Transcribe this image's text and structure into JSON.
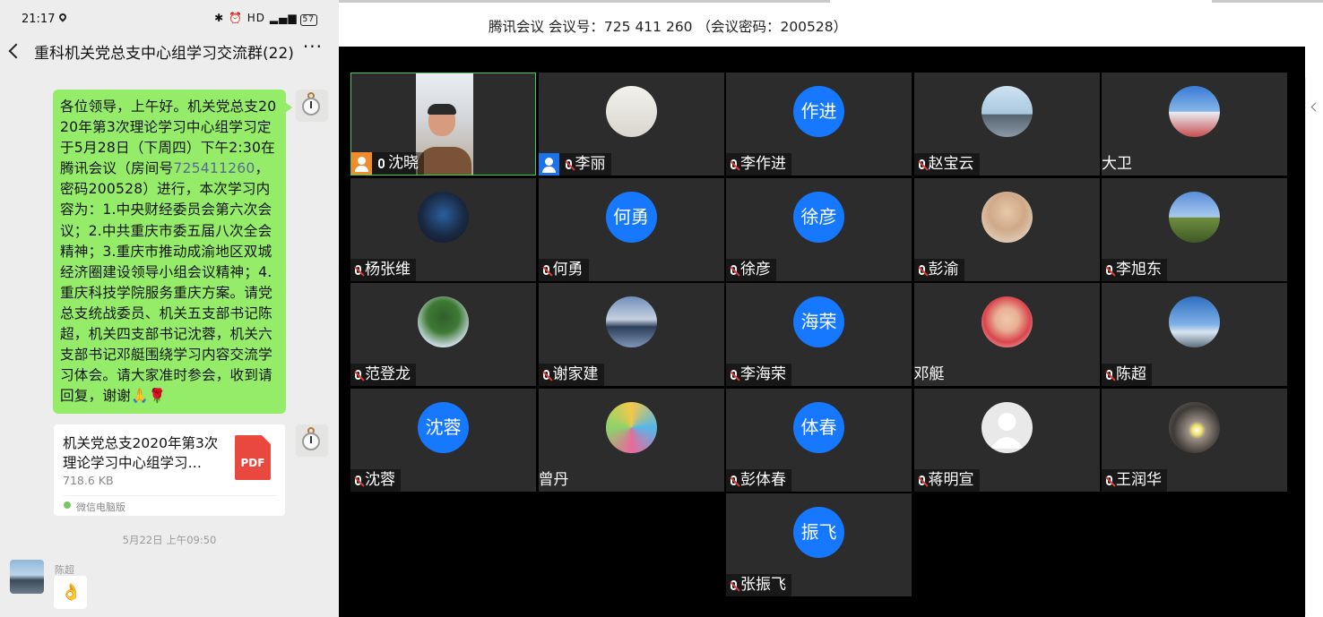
{
  "phone": {
    "status": {
      "time": "21:17",
      "icons": "✱ ⏰ HD",
      "battery": "57"
    },
    "chat": {
      "title": "重科机关党总支中心组学习交流群(22)",
      "more": "···"
    },
    "message1": {
      "text_a": "各位领导，上午好。机关党总支2020年第3次理论学习中心组学习定于5月28日（下周四）下午2:30在腾讯会议（房间号",
      "room_link": "725411260",
      "text_b": "，密码200528）进行，本次学习内容为：1.中央财经委员会第六次会议；2.中共重庆市委五届八次全会精神；3.重庆市推动成渝地区双城经济圈建设领导小组会议精神；4.重庆科技学院服务重庆方案。请党总支统战委员、机关五支部书记陈超，机关四支部书记沈蓉，机关六支部书记邓艇围绕学习内容交流学习体会。请大家准时参会，收到请回复，谢谢🙏🌹"
    },
    "file": {
      "name": "机关党总支2020年第3次理论学习中心组学习…",
      "size": "718.6 KB",
      "badge": "PDF",
      "source": "微信电脑版"
    },
    "timestamp": "5月22日 上午09:50",
    "sender2": {
      "name": "陈超",
      "emoji": "👌"
    }
  },
  "meeting": {
    "title": "腾讯会议 会议号：725 411 260 （会议密码：200528）",
    "accent": "#1678ff",
    "participants": [
      {
        "name": "沈晓",
        "avatar": "camera-video",
        "badge": "host-orange",
        "mic": "on",
        "active": true
      },
      {
        "name": "李丽",
        "avatar": "clock-photo",
        "badge": "host-blue",
        "mic": "muted"
      },
      {
        "name": "李作进",
        "avatar": "text",
        "avatar_text": "作进",
        "mic": "muted"
      },
      {
        "name": "赵宝云",
        "avatar": "city-photo",
        "mic": "muted"
      },
      {
        "name": "大卫",
        "avatar": "person-photo"
      },
      {
        "name": "杨张维",
        "avatar": "sports-photo",
        "mic": "muted"
      },
      {
        "name": "何勇",
        "avatar": "text",
        "avatar_text": "何勇",
        "mic": "muted"
      },
      {
        "name": "徐彦",
        "avatar": "text",
        "avatar_text": "徐彦",
        "mic": "muted"
      },
      {
        "name": "彭渝",
        "avatar": "portrait-photo",
        "mic": "muted"
      },
      {
        "name": "李旭东",
        "avatar": "landscape-photo",
        "mic": "muted"
      },
      {
        "name": "范登龙",
        "avatar": "tree-photo",
        "mic": "muted"
      },
      {
        "name": "谢家建",
        "avatar": "sunset-photo",
        "mic": "muted"
      },
      {
        "name": "李海荣",
        "avatar": "text",
        "avatar_text": "海荣",
        "mic": "muted"
      },
      {
        "name": "邓艇",
        "avatar": "baby-photo"
      },
      {
        "name": "陈超",
        "avatar": "sky-photo",
        "mic": "muted"
      },
      {
        "name": "沈蓉",
        "avatar": "text",
        "avatar_text": "沈蓉",
        "mic": "muted"
      },
      {
        "name": "曾丹",
        "avatar": "colorful-photo"
      },
      {
        "name": "彭体春",
        "avatar": "text",
        "avatar_text": "体春",
        "mic": "muted"
      },
      {
        "name": "蒋明宣",
        "avatar": "default-person",
        "mic": "muted"
      },
      {
        "name": "王润华",
        "avatar": "stones-photo",
        "mic": "muted"
      },
      {
        "name": "张振飞",
        "avatar": "text",
        "avatar_text": "振飞",
        "mic": "muted"
      }
    ]
  }
}
